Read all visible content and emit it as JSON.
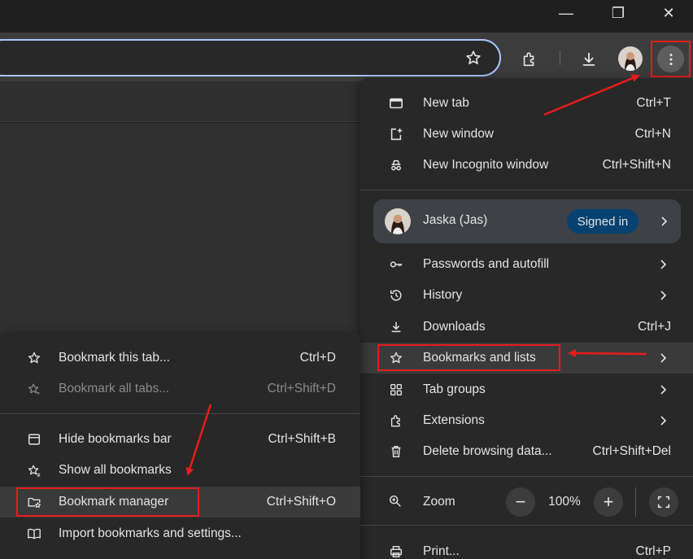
{
  "window": {
    "minimize_glyph": "—",
    "restore_glyph": "❐",
    "close_glyph": "✕"
  },
  "toolbar": {
    "icons": [
      "star-icon",
      "extensions-icon",
      "download-icon",
      "profile-avatar",
      "more-vert-icon"
    ]
  },
  "main_menu": {
    "new_tab": {
      "label": "New tab",
      "shortcut": "Ctrl+T"
    },
    "new_window": {
      "label": "New window",
      "shortcut": "Ctrl+N"
    },
    "new_incognito": {
      "label": "New Incognito window",
      "shortcut": "Ctrl+Shift+N"
    },
    "profile": {
      "name": "Jaska (Jas)",
      "status": "Signed in"
    },
    "passwords": {
      "label": "Passwords and autofill"
    },
    "history": {
      "label": "History"
    },
    "downloads": {
      "label": "Downloads",
      "shortcut": "Ctrl+J"
    },
    "bookmarks": {
      "label": "Bookmarks and lists"
    },
    "tab_groups": {
      "label": "Tab groups"
    },
    "extensions": {
      "label": "Extensions"
    },
    "delete_data": {
      "label": "Delete browsing data...",
      "shortcut": "Ctrl+Shift+Del"
    },
    "zoom": {
      "label": "Zoom",
      "minus": "−",
      "value": "100%",
      "plus": "+"
    },
    "print": {
      "label": "Print...",
      "shortcut": "Ctrl+P"
    }
  },
  "bookmarks_submenu": {
    "bookmark_tab": {
      "label": "Bookmark this tab...",
      "shortcut": "Ctrl+D"
    },
    "bookmark_all": {
      "label": "Bookmark all tabs...",
      "shortcut": "Ctrl+Shift+D"
    },
    "hide_bar": {
      "label": "Hide bookmarks bar",
      "shortcut": "Ctrl+Shift+B"
    },
    "show_all": {
      "label": "Show all bookmarks"
    },
    "manager": {
      "label": "Bookmark manager",
      "shortcut": "Ctrl+Shift+O"
    },
    "import": {
      "label": "Import bookmarks and settings..."
    }
  },
  "colors": {
    "menu_bg": "#282828",
    "highlight_bg": "#3a3a3a",
    "annotation_red": "#e61c1c",
    "signed_in_badge": "#064170",
    "omnibox_border": "#a8c7fa"
  }
}
